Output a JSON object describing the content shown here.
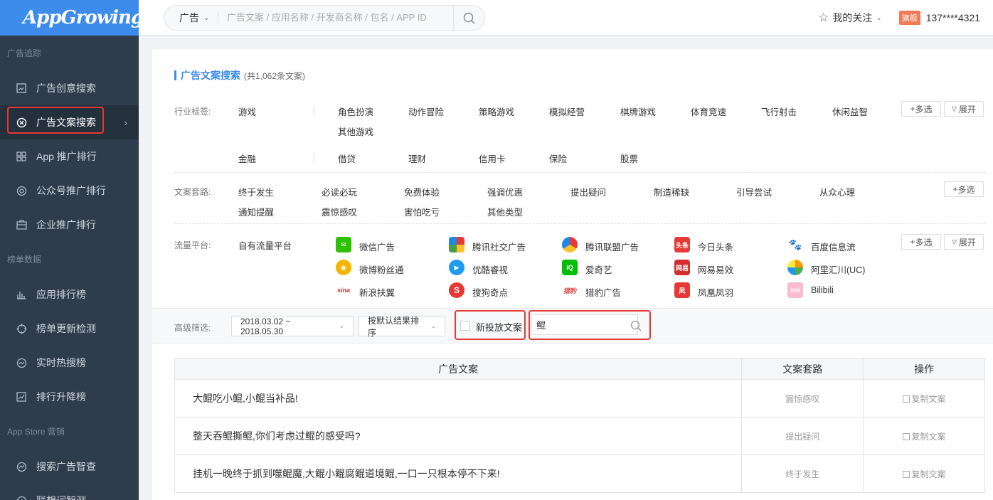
{
  "logo": "AppGrowing",
  "sidebar": {
    "sections": [
      {
        "title": "广告追踪",
        "items": [
          "广告创意搜索",
          "广告文案搜索",
          "App 推广排行",
          "公众号推广排行",
          "企业推广排行"
        ]
      },
      {
        "title": "榜单数据",
        "items": [
          "应用排行榜",
          "榜单更新检测",
          "实时热搜榜",
          "排行升降榜"
        ]
      },
      {
        "title": "App Store 营销",
        "items": [
          "搜索广告智查",
          "联想词智测"
        ]
      }
    ]
  },
  "topbar": {
    "search_type": "广告",
    "search_placeholder": "广告文案 / 应用名称 / 开发商名称 / 包名 / APP ID",
    "follow": "我的关注",
    "vip_badge": "旗舰",
    "phone": "137****4321"
  },
  "page": {
    "title": "广告文案搜索",
    "count": "(共1,062条文案)"
  },
  "filters": {
    "industry_label": "行业标签:",
    "game_primary": "游戏",
    "game_tags": [
      "角色扮演",
      "动作冒险",
      "策略游戏",
      "模拟经营",
      "棋牌游戏",
      "体育竞速",
      "飞行射击",
      "休闲益智",
      "其他游戏"
    ],
    "finance_primary": "金融",
    "finance_tags": [
      "借贷",
      "理财",
      "信用卡",
      "保险",
      "股票"
    ],
    "routine_label": "文案套路:",
    "routine_tags": [
      "终于发生",
      "必读必玩",
      "免费体验",
      "强调优惠",
      "提出疑问",
      "制造稀缺",
      "引导尝试",
      "从众心理",
      "通知提醒",
      "震惊感叹",
      "害怕吃亏",
      "其他类型"
    ],
    "platform_label": "流量平台:",
    "platform_primary": "自有流量平台",
    "platforms": [
      "微信广告",
      "腾讯社交广告",
      "腾讯联盟广告",
      "今日头条",
      "百度信息流",
      "微博粉丝通",
      "优酷睿视",
      "爱奇艺",
      "网易易效",
      "阿里汇川(UC)",
      "新浪扶翼",
      "搜狗奇点",
      "猎豹广告",
      "凤凰凤羽",
      "Bilibili"
    ],
    "multi_select": "多选",
    "expand": "展开"
  },
  "advanced": {
    "label": "高级筛选:",
    "date_range": "2018.03.02 ~ 2018.05.30",
    "sort": "按默认结果排序",
    "new_only": "新投放文案",
    "keyword": "鲲"
  },
  "table": {
    "headers": [
      "广告文案",
      "文案套路",
      "操作"
    ],
    "rows": [
      {
        "text": "大鲲吃小鲲,小鲲当补品!",
        "routine": "震惊感叹",
        "action": "复制文案"
      },
      {
        "text": "整天吞鲲撕鲲,你们考虑过鲲的感受吗?",
        "routine": "提出疑问",
        "action": "复制文案"
      },
      {
        "text": "挂机一晚终于抓到噬鲲魔,大鲲小鲲腐鲲道境鲲,一口一只根本停不下来!",
        "routine": "终于发生",
        "action": "复制文案"
      }
    ]
  },
  "colors": {
    "brand": "#3d8bea",
    "sidebar_bg": "#2f3c4c",
    "highlight": "#e53935"
  }
}
